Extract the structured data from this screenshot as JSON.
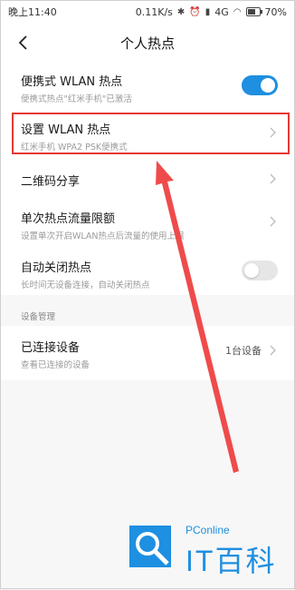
{
  "status_bar": {
    "time": "晚上11:40",
    "speed": "0.11K/s",
    "network": "4G",
    "battery": "70%",
    "battery_level": 0.7
  },
  "header": {
    "back_icon": "chevron-left-icon",
    "title": "个人热点"
  },
  "rows": {
    "portable": {
      "title": "便携式 WLAN 热点",
      "subtitle": "便携式热点\"红米手机\"已激活",
      "toggle_on": true
    },
    "setup": {
      "title": "设置 WLAN 热点",
      "subtitle": "红米手机 WPA2 PSK便携式"
    },
    "qrcode": {
      "title": "二维码分享"
    },
    "limit": {
      "title": "单次热点流量限额",
      "subtitle": "设置单次开启WLAN热点后流量的使用上限"
    },
    "autoclose": {
      "title": "自动关闭热点",
      "subtitle": "长时间无设备连接，自动关闭热点",
      "toggle_on": false
    }
  },
  "device_section": {
    "label": "设备管理",
    "connected": {
      "title": "已连接设备",
      "subtitle": "查看已连接的设备",
      "value": "1台设备"
    }
  },
  "watermark": {
    "brand": "PConline",
    "name": "IT百科"
  },
  "colors": {
    "accent": "#1e8fe1",
    "highlight": "#e53935",
    "arrow": "#ef4b4b"
  }
}
